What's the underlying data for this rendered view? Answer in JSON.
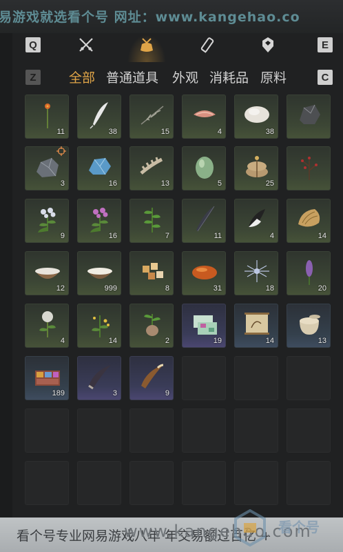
{
  "banner": {
    "text": "易游戏就选看个号  网址：www.kangehao.co"
  },
  "keys": {
    "left_top": "Q",
    "right_top": "E",
    "left_tabs": "Z",
    "right_tabs": "C"
  },
  "categories": [
    {
      "name": "weapon-icon"
    },
    {
      "name": "pouch-icon",
      "selected": true
    },
    {
      "name": "scroll-icon"
    },
    {
      "name": "crest-icon"
    }
  ],
  "tabs": [
    {
      "label": "全部",
      "active": true
    },
    {
      "label": "普通道具"
    },
    {
      "label": "外观"
    },
    {
      "label": "消耗品"
    },
    {
      "label": "原料"
    }
  ],
  "items": [
    {
      "icon": "orange-flower-icon",
      "count": "11"
    },
    {
      "icon": "white-feather-icon",
      "count": "38"
    },
    {
      "icon": "grass-stalk-icon",
      "count": "15"
    },
    {
      "icon": "raw-meat-icon",
      "count": "4"
    },
    {
      "icon": "white-fur-icon",
      "count": "38"
    },
    {
      "icon": "dark-ore-icon",
      "count": ""
    },
    {
      "icon": "gray-stone-icon",
      "count": "3"
    },
    {
      "icon": "blue-crystal-icon",
      "count": "16"
    },
    {
      "icon": "bone-icon",
      "count": "13"
    },
    {
      "icon": "green-melon-icon",
      "count": "5"
    },
    {
      "icon": "grain-sack-icon",
      "count": "25"
    },
    {
      "icon": "red-berry-branch-icon",
      "count": ""
    },
    {
      "icon": "white-flower-herb-icon",
      "count": "9"
    },
    {
      "icon": "pink-flower-herb-icon",
      "count": "16"
    },
    {
      "icon": "green-herb-icon",
      "count": "7"
    },
    {
      "icon": "dark-feather-icon",
      "count": "11"
    },
    {
      "icon": "black-white-feather-icon",
      "count": "4"
    },
    {
      "icon": "shell-icon",
      "count": "14"
    },
    {
      "icon": "milk-bowl-icon",
      "count": "12"
    },
    {
      "icon": "rice-bowl-icon",
      "count": "999"
    },
    {
      "icon": "tofu-cubes-icon",
      "count": "8"
    },
    {
      "icon": "orange-stone-icon",
      "count": "31"
    },
    {
      "icon": "spider-lily-icon",
      "count": "18"
    },
    {
      "icon": "purple-flower-spike-icon",
      "count": "20"
    },
    {
      "icon": "dandelion-icon",
      "count": "4"
    },
    {
      "icon": "yellow-flower-herb-icon",
      "count": "14"
    },
    {
      "icon": "root-herb-icon",
      "count": "2"
    },
    {
      "icon": "gift-box-icon",
      "count": "19"
    },
    {
      "icon": "scroll-painting-icon",
      "count": "14"
    },
    {
      "icon": "ceramic-jar-icon",
      "count": "13"
    },
    {
      "icon": "jewelry-box-icon",
      "count": "189"
    },
    {
      "icon": "dark-horn-icon",
      "count": "3"
    },
    {
      "icon": "bronze-horn-icon",
      "count": "9"
    }
  ],
  "bottom": {
    "text": "看个号专业网易游戏八年  年交易额过百亿  +",
    "watermark": "www.kangehao.com",
    "logo": "看个号"
  },
  "colors": {
    "accent": "#e0a548",
    "slot_green": "#3c4635",
    "slot_purple": "#3a3c58",
    "slot_blue": "#34404c"
  }
}
